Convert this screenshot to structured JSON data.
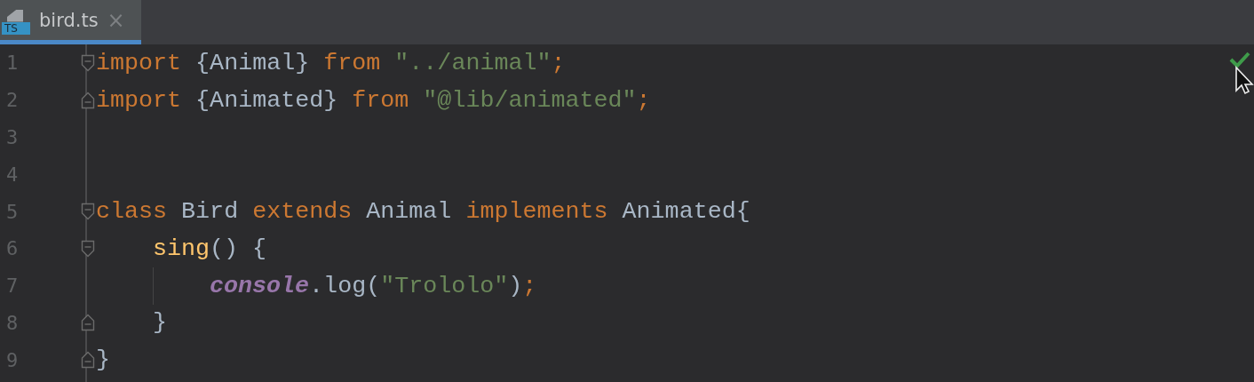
{
  "tabs": [
    {
      "label": "bird.ts",
      "icon_text": "TS",
      "close": "×",
      "selected": true
    }
  ],
  "editor": {
    "lines": [
      {
        "number": "1",
        "kind": "opener",
        "tokens": [
          {
            "kind": "keyword",
            "text": "import"
          },
          {
            "kind": "plain",
            "text": " {Animal} "
          },
          {
            "kind": "keyword",
            "text": "from "
          },
          {
            "kind": "string",
            "text": "\"../animal\""
          },
          {
            "kind": "keyword",
            "text": ";"
          }
        ]
      },
      {
        "number": "2",
        "kind": "closer",
        "tokens": [
          {
            "kind": "keyword",
            "text": "import"
          },
          {
            "kind": "plain",
            "text": " {Animated} "
          },
          {
            "kind": "keyword",
            "text": "from "
          },
          {
            "kind": "string",
            "text": "\"@lib/animated\""
          },
          {
            "kind": "keyword",
            "text": ";"
          }
        ]
      },
      {
        "number": "3"
      },
      {
        "number": "4"
      },
      {
        "number": "5",
        "kind": "opener",
        "tokens": [
          {
            "kind": "keyword",
            "text": "class"
          },
          {
            "kind": "plain",
            "text": " Bird "
          },
          {
            "kind": "keyword",
            "text": "extends"
          },
          {
            "kind": "plain",
            "text": " Animal "
          },
          {
            "kind": "keyword",
            "text": "implements"
          },
          {
            "kind": "plain",
            "text": " Animated{"
          }
        ],
        "children": [
          {
            "number": "6",
            "kind": "opener",
            "tokens": [
              {
                "kind": "func",
                "text": "sing"
              },
              {
                "kind": "plain",
                "text": "() {"
              }
            ],
            "children": [
              {
                "number": "7",
                "tokens": [
                  {
                    "kind": "global",
                    "text": "console"
                  },
                  {
                    "kind": "plain",
                    "text": ".log("
                  },
                  {
                    "kind": "string",
                    "text": "\"Trololo\""
                  },
                  {
                    "kind": "plain",
                    "text": ")"
                  },
                  {
                    "kind": "keyword",
                    "text": ";"
                  }
                ]
              }
            ]
          },
          {
            "number": "8",
            "kind": "closer",
            "tokens": [
              {
                "kind": "plain",
                "text": "}"
              }
            ]
          }
        ]
      },
      {
        "number": "9",
        "kind": "closer",
        "tokens": [
          {
            "kind": "plain",
            "text": "}"
          }
        ]
      }
    ]
  }
}
